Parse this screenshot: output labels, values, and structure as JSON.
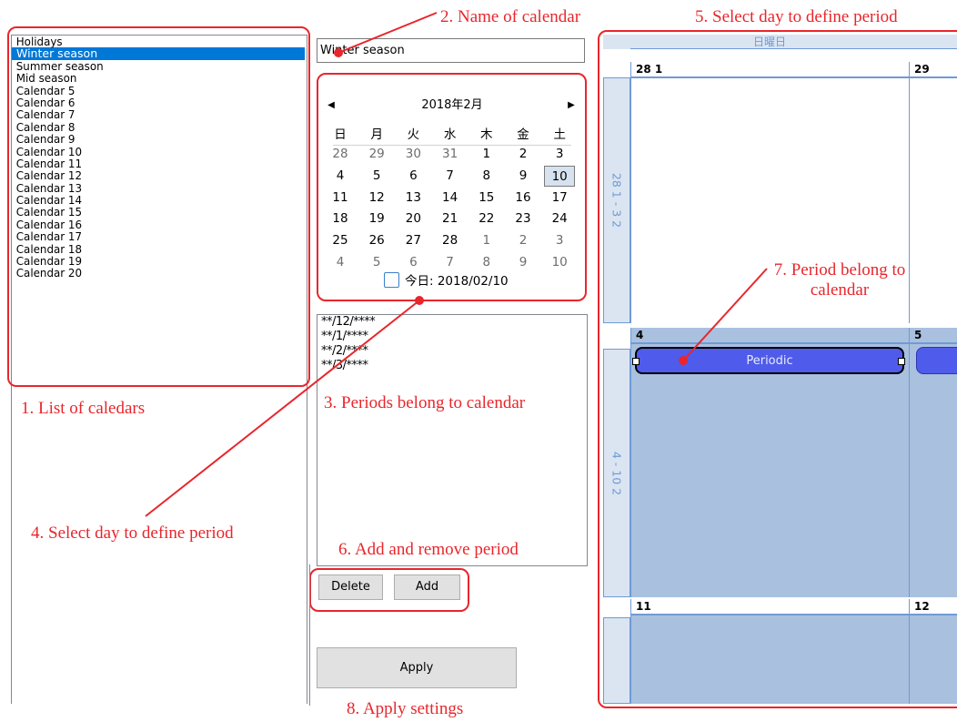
{
  "annotations": {
    "a1": "1. List of caledars",
    "a2": "2. Name of calendar",
    "a3": "3. Periods belong to calendar",
    "a4": "4. Select day to define period",
    "a5": "5. Select day to define period",
    "a6": "6. Add and remove period",
    "a7": "7. Period belong to calendar",
    "a8": "8. Apply settings"
  },
  "calendar_list": {
    "items": [
      "Holidays",
      "Winter season",
      "Summer season",
      "Mid season",
      "Calendar 5",
      "Calendar 6",
      "Calendar 7",
      "Calendar 8",
      "Calendar 9",
      "Calendar 10",
      "Calendar 11",
      "Calendar 12",
      "Calendar 13",
      "Calendar 14",
      "Calendar 15",
      "Calendar 16",
      "Calendar 17",
      "Calendar 18",
      "Calendar 19",
      "Calendar 20"
    ],
    "selected_index": 1
  },
  "calendar_name": {
    "value": "Winter season"
  },
  "month_calendar": {
    "title": "2018年2月",
    "prev_glyph": "◀",
    "next_glyph": "▶",
    "weekdays": [
      "日",
      "月",
      "火",
      "水",
      "木",
      "金",
      "土"
    ],
    "weeks": [
      [
        "28",
        "29",
        "30",
        "31",
        "1",
        "2",
        "3"
      ],
      [
        "4",
        "5",
        "6",
        "7",
        "8",
        "9",
        "10"
      ],
      [
        "11",
        "12",
        "13",
        "14",
        "15",
        "16",
        "17"
      ],
      [
        "18",
        "19",
        "20",
        "21",
        "22",
        "23",
        "24"
      ],
      [
        "25",
        "26",
        "27",
        "28",
        "1",
        "2",
        "3"
      ],
      [
        "4",
        "5",
        "6",
        "7",
        "8",
        "9",
        "10"
      ]
    ],
    "selected_day": "10",
    "today_label": "今日: 2018/02/10"
  },
  "periods": [
    "**/12/****",
    "**/1/****",
    "**/2/****",
    "**/3/****"
  ],
  "buttons": {
    "delete": "Delete",
    "add": "Add",
    "apply": "Apply"
  },
  "schedule": {
    "column_header": "日曜日",
    "row_headers": [
      "28 1 - 3 2",
      "4 - 10 2"
    ],
    "weeks": [
      {
        "days": [
          "28 1",
          "29"
        ]
      },
      {
        "days": [
          "4",
          "5"
        ]
      },
      {
        "days": [
          "11",
          "12"
        ]
      }
    ],
    "event_label": "Periodic"
  },
  "colors": {
    "annotation_red": "#e8262c",
    "selection_blue": "#0078d7",
    "event_blue": "#4f5bea",
    "schedule_blue": "#a9c0df",
    "schedule_line": "#6f9ad7"
  }
}
